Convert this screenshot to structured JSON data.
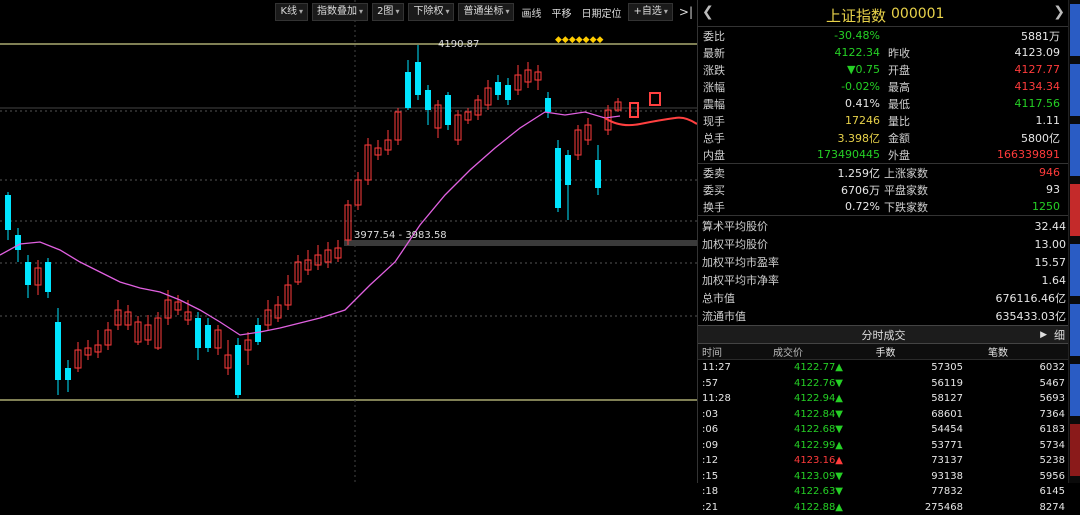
{
  "toolbar": {
    "items": [
      {
        "label": "K线",
        "dropdown": true
      },
      {
        "label": "指数叠加",
        "dropdown": true
      },
      {
        "label": "2图",
        "dropdown": true
      },
      {
        "label": "下除权",
        "dropdown": true
      },
      {
        "label": "普通坐标",
        "dropdown": true
      }
    ],
    "plain": [
      "画线",
      "平移",
      "日期定位"
    ],
    "watchlist": "+自选",
    "collapse": ">|"
  },
  "chart": {
    "high_label": "4190.87",
    "range_label": "3977.54 - 3983.58",
    "diamonds": "◆◆◆◆◆◆◆",
    "colors": {
      "up": "#ff3b3b",
      "down": "#00e5ff",
      "ma": "#e060e0",
      "annot": "#ff4040",
      "hline": "#ffffaa"
    }
  },
  "quote": {
    "name": "上证指数",
    "code": "000001",
    "rows": [
      {
        "l1": "委比",
        "v1": "-30.48%",
        "c1": "green",
        "l2": "",
        "v2": "5881万",
        "c2": "white"
      },
      {
        "l1": "最新",
        "v1": "4122.34",
        "c1": "green",
        "l2": "昨收",
        "v2": "4123.09",
        "c2": "white"
      },
      {
        "l1": "涨跌",
        "v1": "▼0.75",
        "c1": "green",
        "l2": "开盘",
        "v2": "4127.77",
        "c2": "red"
      },
      {
        "l1": "涨幅",
        "v1": "-0.02%",
        "c1": "green",
        "l2": "最高",
        "v2": "4134.34",
        "c2": "red"
      },
      {
        "l1": "震幅",
        "v1": "0.41%",
        "c1": "white",
        "l2": "最低",
        "v2": "4117.56",
        "c2": "green"
      },
      {
        "l1": "现手",
        "v1": "17246",
        "c1": "yellow",
        "l2": "量比",
        "v2": "1.11",
        "c2": "white"
      },
      {
        "l1": "总手",
        "v1": "3.398亿",
        "c1": "yellow",
        "l2": "金额",
        "v2": "5800亿",
        "c2": "white"
      },
      {
        "l1": "内盘",
        "v1": "173490445",
        "c1": "green",
        "l2": "外盘",
        "v2": "166339891",
        "c2": "red"
      }
    ],
    "rows2": [
      {
        "l1": "委卖",
        "v1": "1.259亿",
        "c1": "white",
        "l2": "上涨家数",
        "v2": "946",
        "c2": "red"
      },
      {
        "l1": "委买",
        "v1": "6706万",
        "c1": "white",
        "l2": "平盘家数",
        "v2": "93",
        "c2": "white"
      },
      {
        "l1": "换手",
        "v1": "0.72%",
        "c1": "white",
        "l2": "下跌家数",
        "v2": "1250",
        "c2": "green"
      }
    ],
    "list": [
      {
        "label": "算术平均股价",
        "value": "32.44"
      },
      {
        "label": "加权平均股价",
        "value": "13.00"
      },
      {
        "label": "加权平均市盈率",
        "value": "15.57"
      },
      {
        "label": "加权平均市净率",
        "value": "1.64"
      },
      {
        "label": "总市值",
        "value": "676116.46亿"
      },
      {
        "label": "流通市值",
        "value": "635433.03亿"
      }
    ]
  },
  "ticks": {
    "title": "分时成交",
    "detail": "细",
    "headers": [
      "时间",
      "成交价",
      "手数",
      "笔数"
    ],
    "rows": [
      {
        "time": "11:27",
        "price": "4122.77▲",
        "pc": "green",
        "vol": "57305",
        "cnt": "6032"
      },
      {
        "time": ":57",
        "price": "4122.76▼",
        "pc": "green",
        "vol": "56119",
        "cnt": "5467"
      },
      {
        "time": "11:28",
        "price": "4122.94▲",
        "pc": "green",
        "vol": "58127",
        "cnt": "5693"
      },
      {
        "time": ":03",
        "price": "4122.84▼",
        "pc": "green",
        "vol": "68601",
        "cnt": "7364"
      },
      {
        "time": ":06",
        "price": "4122.68▼",
        "pc": "green",
        "vol": "54454",
        "cnt": "6183"
      },
      {
        "time": ":09",
        "price": "4122.99▲",
        "pc": "green",
        "vol": "53771",
        "cnt": "5734"
      },
      {
        "time": ":12",
        "price": "4123.16▲",
        "pc": "red",
        "vol": "73137",
        "cnt": "5238"
      },
      {
        "time": ":15",
        "price": "4123.09▼",
        "pc": "green",
        "vol": "93138",
        "cnt": "5956"
      },
      {
        "time": ":18",
        "price": "4122.63▼",
        "pc": "green",
        "vol": "77832",
        "cnt": "6145"
      },
      {
        "time": ":21",
        "price": "4122.88▲",
        "pc": "green",
        "vol": "275468",
        "cnt": "8274"
      }
    ]
  },
  "side_colors": [
    "#2a5cc4",
    "#2a5cc4",
    "#2a5cc4",
    "#c42a2a",
    "#2a5cc4",
    "#2a5cc4",
    "#2a5cc4",
    "#8a1a1a"
  ]
}
